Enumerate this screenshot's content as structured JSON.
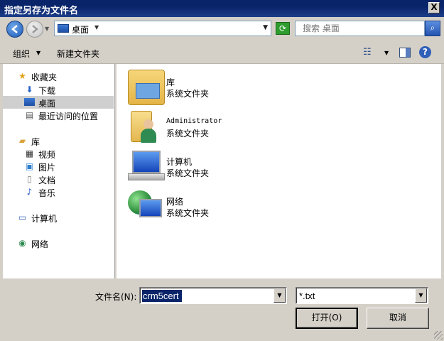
{
  "window": {
    "title": "指定另存为文件名",
    "close_label": "X"
  },
  "navbar": {
    "address_crumb": "桌面",
    "search_placeholder": "搜索 桌面"
  },
  "toolbar": {
    "organize_label": "组织",
    "new_folder_label": "新建文件夹",
    "help_label": "?"
  },
  "sidebar": {
    "items": [
      {
        "label": "收藏夹",
        "icon": "star-icon",
        "level": 0,
        "selected": false
      },
      {
        "label": "下载",
        "icon": "download-folder-icon",
        "level": 1,
        "selected": false
      },
      {
        "label": "桌面",
        "icon": "desktop-icon",
        "level": 1,
        "selected": true
      },
      {
        "label": "最近访问的位置",
        "icon": "recent-places-icon",
        "level": 1,
        "selected": false
      },
      {
        "label": "库",
        "icon": "library-icon",
        "level": 0,
        "selected": false
      },
      {
        "label": "视频",
        "icon": "video-icon",
        "level": 1,
        "selected": false
      },
      {
        "label": "图片",
        "icon": "picture-icon",
        "level": 1,
        "selected": false
      },
      {
        "label": "文档",
        "icon": "document-icon",
        "level": 1,
        "selected": false
      },
      {
        "label": "音乐",
        "icon": "music-icon",
        "level": 1,
        "selected": false
      },
      {
        "label": "计算机",
        "icon": "computer-icon",
        "level": 0,
        "selected": false
      },
      {
        "label": "网络",
        "icon": "network-icon",
        "level": 0,
        "selected": false
      }
    ]
  },
  "content": {
    "items": [
      {
        "name": "库",
        "type": "系统文件夹",
        "icon": "library-folder-icon"
      },
      {
        "name": "Administrator",
        "type": "系统文件夹",
        "icon": "user-folder-icon"
      },
      {
        "name": "计算机",
        "type": "系统文件夹",
        "icon": "computer-icon"
      },
      {
        "name": "网络",
        "type": "系统文件夹",
        "icon": "network-icon"
      }
    ]
  },
  "footer": {
    "filename_label": "文件名(N):",
    "filename_value": "crm5cert",
    "filetype_value": "*.txt",
    "open_label": "打开(O)",
    "cancel_label": "取消"
  },
  "colors": {
    "title_bar": "#0a246a",
    "selection": "#0a246a",
    "face": "#d4d0c8",
    "selected_row": "#cfcfcf"
  }
}
